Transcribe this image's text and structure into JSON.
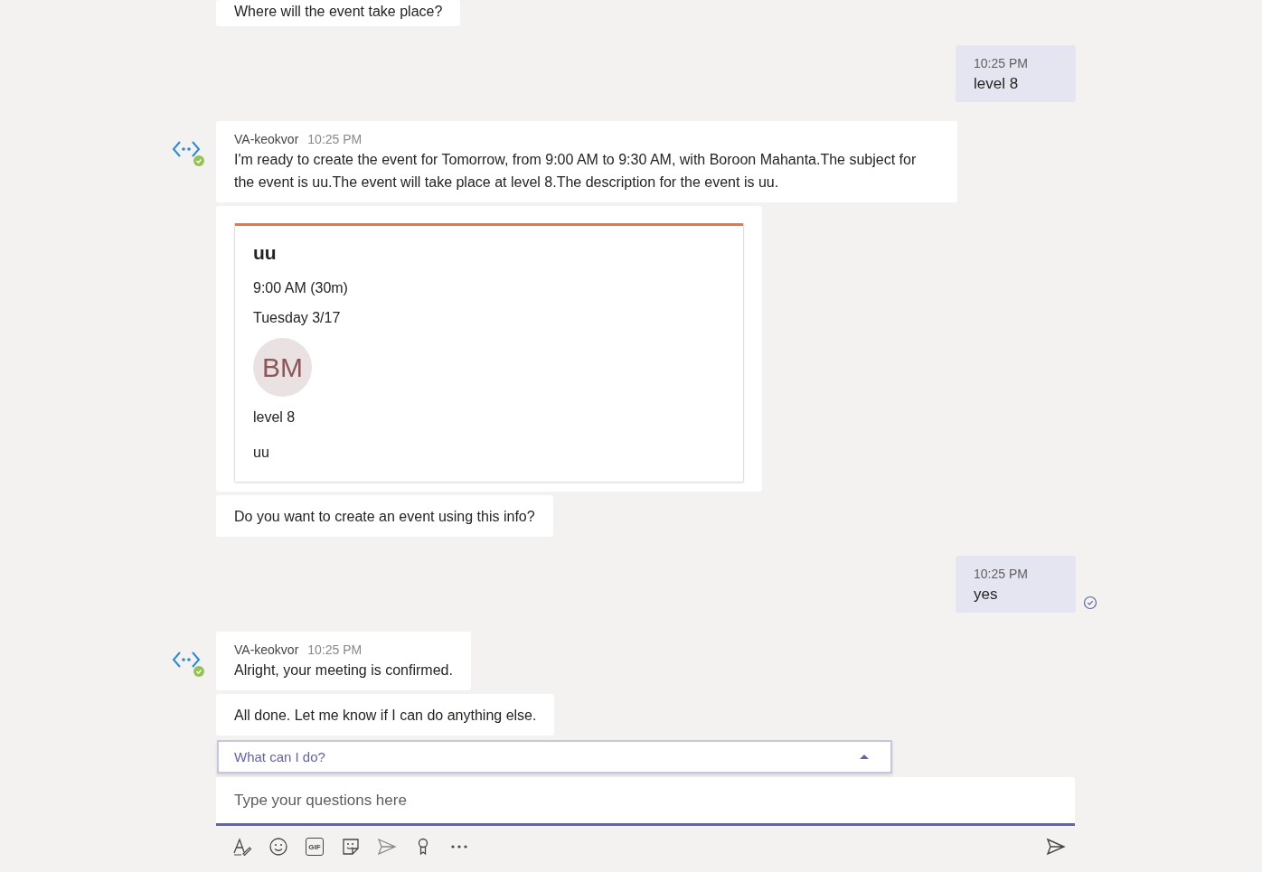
{
  "messages": [
    {
      "kind": "bot",
      "bubbles": [
        {
          "kind": "text",
          "text": "Where will the event take place?"
        }
      ]
    },
    {
      "kind": "me",
      "time": "10:25 PM",
      "text": "level 8",
      "read": false
    },
    {
      "kind": "bot",
      "bubbles": [
        {
          "kind": "text",
          "sender": "VA-keokvor",
          "time": "10:25 PM",
          "text": "I'm ready to create the event for Tomorrow, from 9:00 AM to 9:30 AM, with Boroon Mahanta.The subject for the event is uu.The event will take place at level 8.The description for the event is uu."
        },
        {
          "kind": "card",
          "title": "uu",
          "when": "9:00 AM (30m)",
          "date": "Tuesday 3/17",
          "initials": "BM",
          "location": "level 8",
          "description": "uu"
        },
        {
          "kind": "text",
          "text": "Do you want to create an event using this info?"
        }
      ]
    },
    {
      "kind": "me",
      "time": "10:25 PM",
      "text": "yes",
      "read": true
    },
    {
      "kind": "bot",
      "bubbles": [
        {
          "kind": "text",
          "sender": "VA-keokvor",
          "time": "10:25 PM",
          "text": "Alright, your meeting is confirmed."
        },
        {
          "kind": "text",
          "text": "All done. Let me know if I can do anything else."
        }
      ]
    }
  ],
  "suggestions": {
    "label": "What can I do?",
    "expanded": true
  },
  "composer": {
    "placeholder": "Type your questions here",
    "toolbar": [
      {
        "kind": "format"
      },
      {
        "kind": "emoji"
      },
      {
        "kind": "gif",
        "text": "GIF"
      },
      {
        "kind": "sticker"
      },
      {
        "kind": "meet"
      },
      {
        "kind": "praise"
      },
      {
        "kind": "more"
      }
    ]
  }
}
